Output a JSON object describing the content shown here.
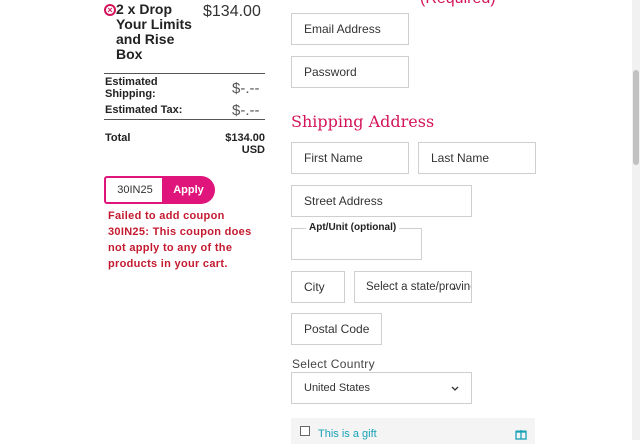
{
  "order": {
    "item_name": "2 x Drop Your Limits and Rise Box",
    "item_price": "$134.00",
    "shipping_label": "Estimated Shipping:",
    "shipping_value": "$-.--",
    "tax_label": "Estimated Tax:",
    "tax_value": "$-.--",
    "total_label": "Total",
    "total_amount": "$134.00",
    "total_currency": "USD"
  },
  "coupon": {
    "value": "30IN25",
    "apply_label": "Apply",
    "error": "Failed to add coupon 30IN25: This coupon does not apply to any of the products in your cart."
  },
  "account": {
    "email_placeholder": "Email Address",
    "password_placeholder": "Password",
    "top_heading_fragment": "(Required)"
  },
  "shipping": {
    "heading": "Shipping Address",
    "first_name_placeholder": "First Name",
    "last_name_placeholder": "Last Name",
    "street_placeholder": "Street Address",
    "apt_label": "Apt/Unit (optional)",
    "city_placeholder": "City",
    "state_placeholder": "Select a state/province",
    "postal_placeholder": "Postal Code",
    "country_label": "Select Country",
    "country_value": "United States",
    "gift_label": "This is a gift"
  },
  "colors": {
    "accent": "#e0157b",
    "heading": "#d4145a",
    "error": "#c41a30",
    "gift_text": "#17a2b8"
  }
}
